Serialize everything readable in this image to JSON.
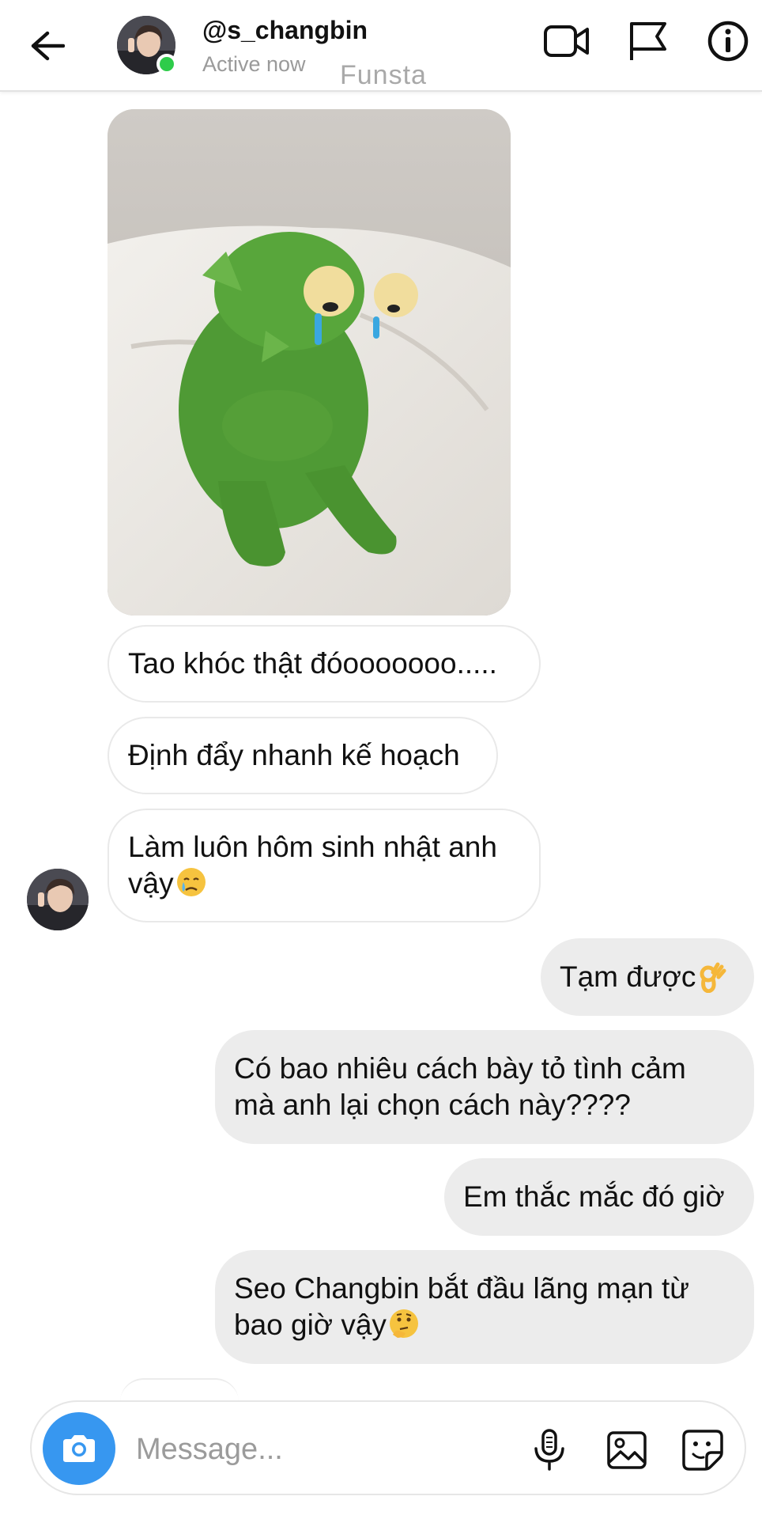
{
  "header": {
    "username": "@s_changbin",
    "status": "Active now",
    "subtitle": "Funsta"
  },
  "messages": [
    {
      "side": "in",
      "text": "Tao khóc thật đóooooooo....."
    },
    {
      "side": "in",
      "text": "Định đẩy nhanh kế hoạch"
    },
    {
      "side": "in",
      "line1": "Làm luôn hôm sinh nhật anh",
      "line2": "vậy",
      "emoji": "crying-face"
    },
    {
      "side": "out",
      "text": "Tạm được",
      "emoji": "ok-hand"
    },
    {
      "side": "out",
      "line1": "Có bao nhiêu cách bày tỏ tình cảm",
      "line2": "mà anh lại chọn cách này????"
    },
    {
      "side": "out",
      "text": "Em thắc mắc đó giờ"
    },
    {
      "side": "out",
      "line1": "Seo Changbin bắt đầu lãng mạn từ",
      "line2": "bao giờ vậy",
      "emoji": "thinking-face"
    }
  ],
  "composer": {
    "placeholder": "Message..."
  },
  "colors": {
    "accent": "#3797f0",
    "online": "#2ecc4a",
    "outgoing_bubble": "#ececec"
  },
  "icons": [
    "back-arrow-icon",
    "video-call-icon",
    "flag-icon",
    "info-icon",
    "camera-icon",
    "microphone-icon",
    "gallery-icon",
    "sticker-icon"
  ]
}
